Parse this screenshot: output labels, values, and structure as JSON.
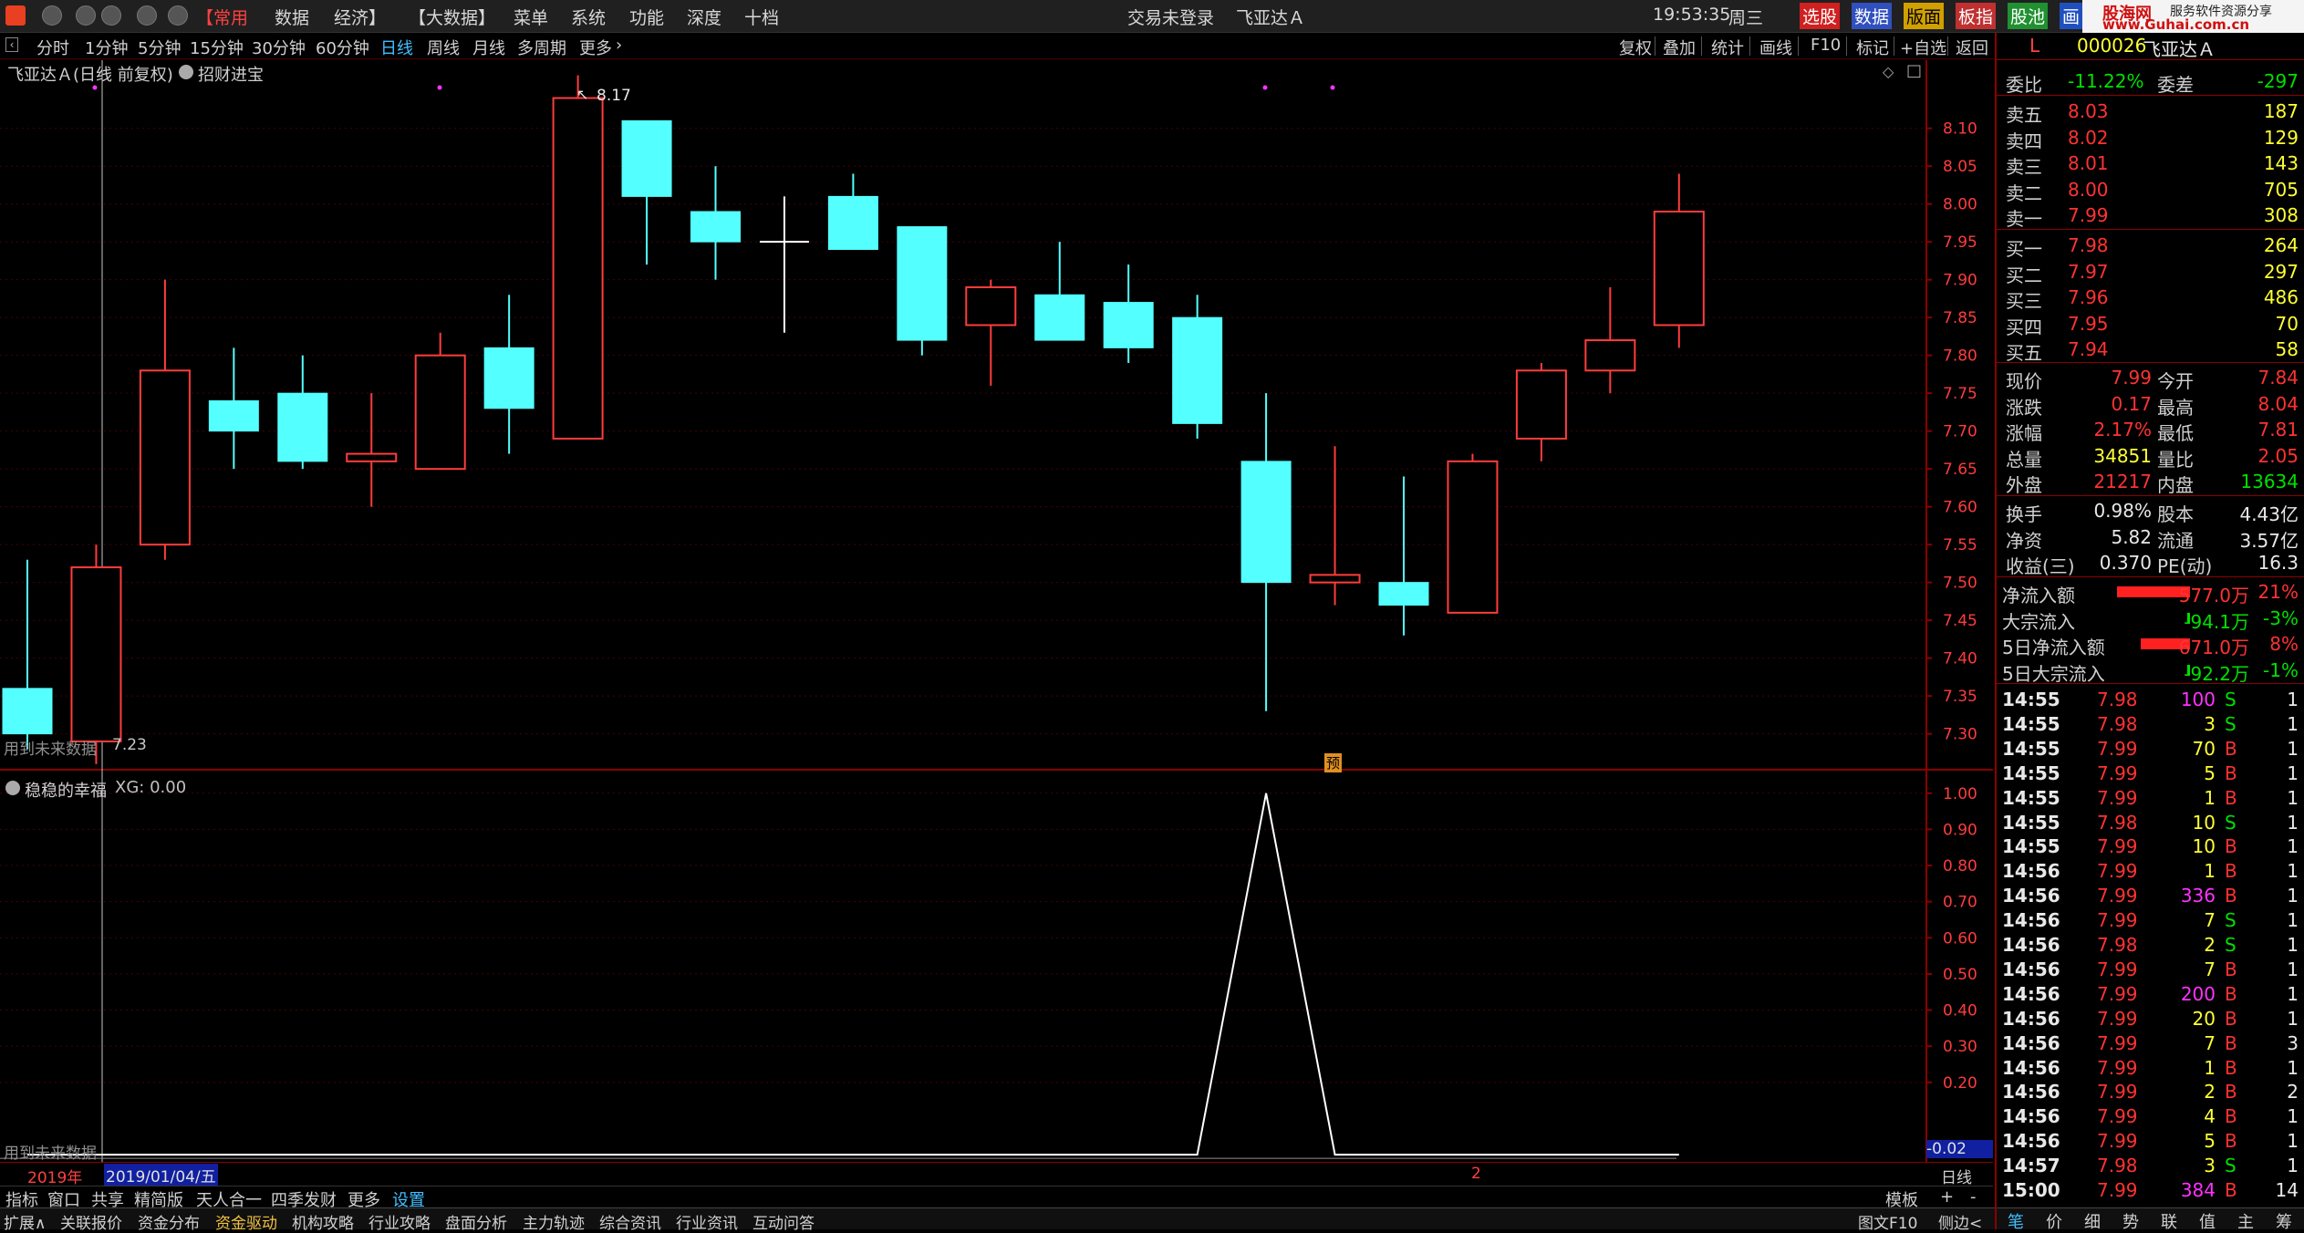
{
  "menubar": {
    "items": [
      "【常用",
      "数据",
      "经济】",
      "【大数据】",
      "菜单",
      "系统",
      "功能",
      "深度",
      "十档"
    ],
    "login_status": "交易未登录",
    "stock_name": "飞亚达Ａ",
    "time": "19:53:35",
    "weekday": "周三",
    "quick_buttons": [
      "选股",
      "数据",
      "版面",
      "板指",
      "股池",
      "画"
    ],
    "watermark": "股海网",
    "watermark_sub": "服务软件资源分享",
    "watermark_url": "www.Guhai.com.cn"
  },
  "periodbar": {
    "periods": [
      "分时",
      "1分钟",
      "5分钟",
      "15分钟",
      "30分钟",
      "60分钟",
      "日线",
      "周线",
      "月线",
      "多周期",
      "更多"
    ],
    "active": "日线",
    "tools": [
      "复权",
      "叠加",
      "统计",
      "画线",
      "F10",
      "标记",
      "+自选",
      "返回"
    ]
  },
  "main_chart": {
    "title": "飞亚达Ａ(日线 前复权)",
    "indicator": "招财进宝",
    "max_label": "8.17",
    "min_label": "7.23",
    "future_note": "用到未来数据",
    "yu_badge": "预",
    "y_ticks": [
      "8.10",
      "8.05",
      "8.00",
      "7.95",
      "7.90",
      "7.85",
      "7.80",
      "7.75",
      "7.70",
      "7.65",
      "7.60",
      "7.55",
      "7.50",
      "7.45",
      "7.40",
      "7.35",
      "7.30"
    ]
  },
  "sub_chart": {
    "title": "稳稳的幸福",
    "xg_label": "XG: 0.00",
    "future_note": "用到未来数据",
    "y_ticks": [
      "1.00",
      "0.90",
      "0.80",
      "0.70",
      "0.60",
      "0.50",
      "0.40",
      "0.30",
      "0.20"
    ],
    "current_value": "-0.02"
  },
  "chart_data": {
    "type": "candlestick",
    "candles": [
      {
        "o": 7.36,
        "c": 7.3,
        "h": 7.53,
        "l": 7.28
      },
      {
        "o": 7.29,
        "c": 7.52,
        "h": 7.55,
        "l": 7.26
      },
      {
        "o": 7.55,
        "c": 7.78,
        "h": 7.9,
        "l": 7.53
      },
      {
        "o": 7.74,
        "c": 7.7,
        "h": 7.81,
        "l": 7.65
      },
      {
        "o": 7.75,
        "c": 7.66,
        "h": 7.8,
        "l": 7.65
      },
      {
        "o": 7.66,
        "c": 7.67,
        "h": 7.75,
        "l": 7.6
      },
      {
        "o": 7.65,
        "c": 7.8,
        "h": 7.83,
        "l": 7.65
      },
      {
        "o": 7.81,
        "c": 7.73,
        "h": 7.88,
        "l": 7.67
      },
      {
        "o": 7.69,
        "c": 8.14,
        "h": 8.17,
        "l": 7.69
      },
      {
        "o": 8.11,
        "c": 8.01,
        "h": 8.11,
        "l": 7.92
      },
      {
        "o": 7.99,
        "c": 7.95,
        "h": 8.05,
        "l": 7.9
      },
      {
        "o": 7.95,
        "c": 7.95,
        "h": 8.01,
        "l": 7.83
      },
      {
        "o": 8.01,
        "c": 7.94,
        "h": 8.04,
        "l": 7.94
      },
      {
        "o": 7.97,
        "c": 7.82,
        "h": 7.97,
        "l": 7.8
      },
      {
        "o": 7.84,
        "c": 7.89,
        "h": 7.9,
        "l": 7.76
      },
      {
        "o": 7.88,
        "c": 7.82,
        "h": 7.95,
        "l": 7.82
      },
      {
        "o": 7.87,
        "c": 7.81,
        "h": 7.92,
        "l": 7.79
      },
      {
        "o": 7.85,
        "c": 7.71,
        "h": 7.88,
        "l": 7.69
      },
      {
        "o": 7.66,
        "c": 7.5,
        "h": 7.75,
        "l": 7.33
      },
      {
        "o": 7.5,
        "c": 7.51,
        "h": 7.68,
        "l": 7.47
      },
      {
        "o": 7.5,
        "c": 7.47,
        "h": 7.64,
        "l": 7.43
      },
      {
        "o": 7.46,
        "c": 7.66,
        "h": 7.67,
        "l": 7.46
      },
      {
        "o": 7.69,
        "c": 7.78,
        "h": 7.79,
        "l": 7.66
      },
      {
        "o": 7.78,
        "c": 7.82,
        "h": 7.89,
        "l": 7.75
      },
      {
        "o": 7.84,
        "c": 7.99,
        "h": 8.04,
        "l": 7.81
      }
    ],
    "ylim": [
      7.255,
      8.19
    ],
    "signal_values": [
      0,
      0,
      0,
      0,
      0,
      0,
      0,
      0,
      0,
      0,
      0,
      0,
      0,
      0,
      0,
      0,
      0,
      0,
      1,
      0,
      0,
      0,
      0,
      0,
      0
    ],
    "signal_ylim": [
      -0.02,
      1.06
    ]
  },
  "dateaxis": {
    "year": "2019年",
    "date": "2019/01/04/五",
    "month": "2",
    "period": "日线"
  },
  "bottomtabs": {
    "items": [
      "指标",
      "窗口",
      "共享",
      "精简版",
      "天人合一",
      "四季发财",
      "更多",
      "设置"
    ],
    "right": [
      "模板",
      "+",
      "-"
    ]
  },
  "statusbar": {
    "items": [
      "扩展∧",
      "关联报价",
      "资金分布",
      "资金驱动",
      "机构攻略",
      "行业攻略",
      "盘面分析",
      "主力轨迹",
      "综合资讯",
      "行业资讯",
      "互动问答"
    ],
    "right": [
      "图文F10",
      "侧边<"
    ]
  },
  "quote": {
    "l_label": "L",
    "code": "000026",
    "name": "飞亚达Ａ",
    "weibi_label": "委比",
    "weibi": "-11.22%",
    "weicha_label": "委差",
    "weicha": "-297",
    "asks": [
      {
        "label": "卖五",
        "price": "8.03",
        "vol": "187"
      },
      {
        "label": "卖四",
        "price": "8.02",
        "vol": "129"
      },
      {
        "label": "卖三",
        "price": "8.01",
        "vol": "143"
      },
      {
        "label": "卖二",
        "price": "8.00",
        "vol": "705"
      },
      {
        "label": "卖一",
        "price": "7.99",
        "vol": "308"
      }
    ],
    "bids": [
      {
        "label": "买一",
        "price": "7.98",
        "vol": "264"
      },
      {
        "label": "买二",
        "price": "7.97",
        "vol": "297"
      },
      {
        "label": "买三",
        "price": "7.96",
        "vol": "486"
      },
      {
        "label": "买四",
        "price": "7.95",
        "vol": "70"
      },
      {
        "label": "买五",
        "price": "7.94",
        "vol": "58"
      }
    ],
    "stats": [
      {
        "l1": "现价",
        "v1": "7.99",
        "c1": "red",
        "l2": "今开",
        "v2": "7.84",
        "c2": "red"
      },
      {
        "l1": "涨跌",
        "v1": "0.17",
        "c1": "red",
        "l2": "最高",
        "v2": "8.04",
        "c2": "red"
      },
      {
        "l1": "涨幅",
        "v1": "2.17%",
        "c1": "red",
        "l2": "最低",
        "v2": "7.81",
        "c2": "red"
      },
      {
        "l1": "总量",
        "v1": "34851",
        "c1": "yel",
        "l2": "量比",
        "v2": "2.05",
        "c2": "red"
      },
      {
        "l1": "外盘",
        "v1": "21217",
        "c1": "red",
        "l2": "内盘",
        "v2": "13634",
        "c2": "grn"
      }
    ],
    "fund": [
      {
        "l1": "换手",
        "v1": "0.98%",
        "l2": "股本",
        "v2": "4.43亿"
      },
      {
        "l1": "净资",
        "v1": "5.82",
        "l2": "流通",
        "v2": "3.57亿"
      },
      {
        "l1": "收益(三)",
        "v1": "0.370",
        "l2": "PE(动)",
        "v2": "16.3"
      }
    ],
    "flows": [
      {
        "label": "净流入额",
        "value": "577.0万",
        "pct": "21%",
        "color": "red",
        "bar": 1.0
      },
      {
        "label": "大宗流入",
        "value": "-94.1万",
        "pct": "-3%",
        "color": "grn",
        "bar": 0.04
      },
      {
        "label": "5日净流入额",
        "value": "671.0万",
        "pct": "8%",
        "color": "red",
        "bar": 0.68
      },
      {
        "label": "5日大宗流入",
        "value": "-92.2万",
        "pct": "-1%",
        "color": "grn",
        "bar": 0.04
      }
    ],
    "ticks": [
      {
        "t": "14:55",
        "p": "7.98",
        "pc": "red",
        "v": "100",
        "vc": "mag",
        "d": "S",
        "n": "1"
      },
      {
        "t": "14:55",
        "p": "7.98",
        "pc": "red",
        "v": "3",
        "vc": "yel",
        "d": "S",
        "n": "1"
      },
      {
        "t": "14:55",
        "p": "7.99",
        "pc": "red",
        "v": "70",
        "vc": "yel",
        "d": "B",
        "n": "1"
      },
      {
        "t": "14:55",
        "p": "7.99",
        "pc": "red",
        "v": "5",
        "vc": "yel",
        "d": "B",
        "n": "1"
      },
      {
        "t": "14:55",
        "p": "7.99",
        "pc": "red",
        "v": "1",
        "vc": "yel",
        "d": "B",
        "n": "1"
      },
      {
        "t": "14:55",
        "p": "7.98",
        "pc": "red",
        "v": "10",
        "vc": "yel",
        "d": "S",
        "n": "1"
      },
      {
        "t": "14:55",
        "p": "7.99",
        "pc": "red",
        "v": "10",
        "vc": "yel",
        "d": "B",
        "n": "1"
      },
      {
        "t": "14:56",
        "p": "7.99",
        "pc": "red",
        "v": "1",
        "vc": "yel",
        "d": "B",
        "n": "1"
      },
      {
        "t": "14:56",
        "p": "7.99",
        "pc": "red",
        "v": "336",
        "vc": "mag",
        "d": "B",
        "n": "1"
      },
      {
        "t": "14:56",
        "p": "7.99",
        "pc": "red",
        "v": "7",
        "vc": "yel",
        "d": "S",
        "n": "1"
      },
      {
        "t": "14:56",
        "p": "7.98",
        "pc": "red",
        "v": "2",
        "vc": "yel",
        "d": "S",
        "n": "1"
      },
      {
        "t": "14:56",
        "p": "7.99",
        "pc": "red",
        "v": "7",
        "vc": "yel",
        "d": "B",
        "n": "1"
      },
      {
        "t": "14:56",
        "p": "7.99",
        "pc": "red",
        "v": "200",
        "vc": "mag",
        "d": "B",
        "n": "1"
      },
      {
        "t": "14:56",
        "p": "7.99",
        "pc": "red",
        "v": "20",
        "vc": "yel",
        "d": "B",
        "n": "1"
      },
      {
        "t": "14:56",
        "p": "7.99",
        "pc": "red",
        "v": "7",
        "vc": "yel",
        "d": "B",
        "n": "3"
      },
      {
        "t": "14:56",
        "p": "7.99",
        "pc": "red",
        "v": "1",
        "vc": "yel",
        "d": "B",
        "n": "1"
      },
      {
        "t": "14:56",
        "p": "7.99",
        "pc": "red",
        "v": "2",
        "vc": "yel",
        "d": "B",
        "n": "2"
      },
      {
        "t": "14:56",
        "p": "7.99",
        "pc": "red",
        "v": "4",
        "vc": "yel",
        "d": "B",
        "n": "1"
      },
      {
        "t": "14:56",
        "p": "7.99",
        "pc": "red",
        "v": "5",
        "vc": "yel",
        "d": "B",
        "n": "1"
      },
      {
        "t": "14:57",
        "p": "7.98",
        "pc": "red",
        "v": "3",
        "vc": "yel",
        "d": "S",
        "n": "1"
      },
      {
        "t": "15:00",
        "p": "7.99",
        "pc": "red",
        "v": "384",
        "vc": "mag",
        "d": "B",
        "n": "14"
      }
    ],
    "bottom_tabs": [
      "笔",
      "价",
      "细",
      "势",
      "联",
      "值",
      "主",
      "筹"
    ]
  },
  "colors": {
    "up": "#ff3c3c",
    "down": "#54ffff",
    "frame": "#8b0000",
    "grid": "#4a0000"
  }
}
